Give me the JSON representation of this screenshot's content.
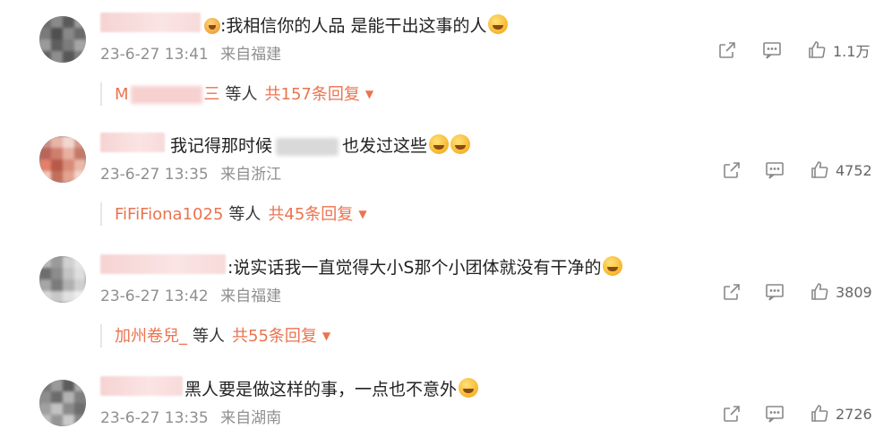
{
  "comments": [
    {
      "text_prefix": ":我相信你的人品 是能干出这事的人",
      "timestamp": "23-6-27 13:41",
      "location": "来自福建",
      "likes": "1.1万",
      "reply_names": "M",
      "reply_names_suffix": "三",
      "reply_etc": "等人",
      "reply_total": "共157条回复"
    },
    {
      "text_prefix": "我记得那时候",
      "text_suffix": "也发过这些",
      "timestamp": "23-6-27 13:35",
      "location": "来自浙江",
      "likes": "4752",
      "reply_names": "FiFiFiona1025",
      "reply_etc": "等人",
      "reply_total": "共45条回复"
    },
    {
      "text_prefix": ":说实话我一直觉得大小S那个小团体就没有干净的",
      "timestamp": "23-6-27 13:42",
      "location": "来自福建",
      "likes": "3809",
      "reply_names": "加州卷兒_",
      "reply_etc": "等人",
      "reply_total": "共55条回复"
    },
    {
      "text_prefix": "黑人要是做这样的事，一点也不意外",
      "timestamp": "23-6-27 13:35",
      "location": "来自湖南",
      "likes": "2726"
    }
  ],
  "icons": {
    "share": "share-icon",
    "comment": "comment-icon",
    "like": "like-icon",
    "expand": "chevron-down-icon"
  },
  "colors": {
    "accent": "#eb7350",
    "meta": "#8f8f8f",
    "text": "#222222"
  }
}
